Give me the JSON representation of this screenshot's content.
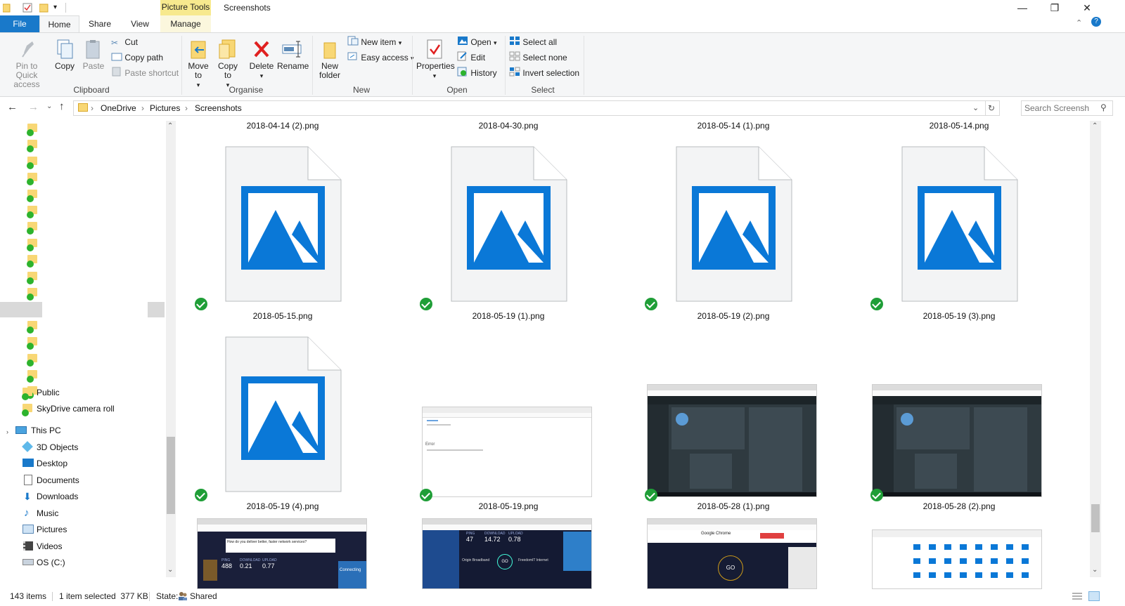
{
  "title_bar": {
    "context_tab": "Picture Tools",
    "window_title": "Screenshots",
    "minimize": "—",
    "restore": "❐",
    "close": "✕"
  },
  "tabs": {
    "file": "File",
    "home": "Home",
    "share": "Share",
    "view": "View",
    "manage": "Manage"
  },
  "ribbon": {
    "clipboard": {
      "pin": "Pin to Quick access",
      "copy": "Copy",
      "paste": "Paste",
      "cut": "Cut",
      "copy_path": "Copy path",
      "paste_shortcut": "Paste shortcut",
      "label": "Clipboard"
    },
    "organise": {
      "move_to": "Move to",
      "copy_to": "Copy to",
      "delete": "Delete",
      "rename": "Rename",
      "label": "Organise"
    },
    "new": {
      "new_folder": "New folder",
      "new_item": "New item",
      "easy_access": "Easy access",
      "label": "New"
    },
    "open": {
      "properties": "Properties",
      "open": "Open",
      "edit": "Edit",
      "history": "History",
      "label": "Open"
    },
    "select": {
      "select_all": "Select all",
      "select_none": "Select none",
      "invert_selection": "Invert selection",
      "label": "Select"
    }
  },
  "address": {
    "crumbs": [
      "OneDrive",
      "Pictures",
      "Screenshots"
    ],
    "search_placeholder": "Search Screensh"
  },
  "nav_pane": {
    "onedrive_folder_count": 17,
    "items": [
      {
        "label": "Public",
        "icon": "folder-icon"
      },
      {
        "label": "SkyDrive camera roll",
        "icon": "folder-icon"
      },
      {
        "label": "This PC",
        "icon": "pc-icon"
      },
      {
        "label": "3D Objects",
        "icon": "cube-icon"
      },
      {
        "label": "Desktop",
        "icon": "desktop-icon"
      },
      {
        "label": "Documents",
        "icon": "documents-icon"
      },
      {
        "label": "Downloads",
        "icon": "download-icon"
      },
      {
        "label": "Music",
        "icon": "music-icon"
      },
      {
        "label": "Pictures",
        "icon": "pictures-icon"
      },
      {
        "label": "Videos",
        "icon": "videos-icon"
      },
      {
        "label": "OS (C:)",
        "icon": "drive-icon"
      }
    ]
  },
  "files": {
    "row0_labels": [
      "2018-04-14 (2).png",
      "2018-04-30.png",
      "2018-05-14 (1).png",
      "2018-05-14.png"
    ],
    "row1": [
      "2018-05-15.png",
      "2018-05-19 (1).png",
      "2018-05-19 (2).png",
      "2018-05-19 (3).png"
    ],
    "row2": [
      "2018-05-19 (4).png",
      "2018-05-19.png",
      "2018-05-28 (1).png",
      "2018-05-28 (2).png"
    ],
    "thumb_text": {
      "error_title": "Error",
      "speedtest_question": "How do you deliver better, faster network services?",
      "chrome_title": "Google Chrome",
      "go": "GO",
      "download_label": "DOWNLOAD",
      "upload_label": "UPLOAD",
      "ping_label": "PING",
      "ping_val": "488",
      "download_val": "0.21",
      "upload_val": "0.77",
      "ping_val_b": "47",
      "download_val_b": "14.72",
      "upload_val_b": "0.78",
      "origin": "Origin Broadband",
      "freedom": "FreedomIT Internet",
      "connecting": "Connecting"
    }
  },
  "status": {
    "items": "143 items",
    "selected": "1 item selected  377 KB",
    "state_label": "State:",
    "state_value": "Shared"
  },
  "colors": {
    "accent": "#1979ca",
    "picture_tools": "#f7e98e",
    "sync_green": "#1f9e37",
    "image_blue": "#0a78d7"
  }
}
